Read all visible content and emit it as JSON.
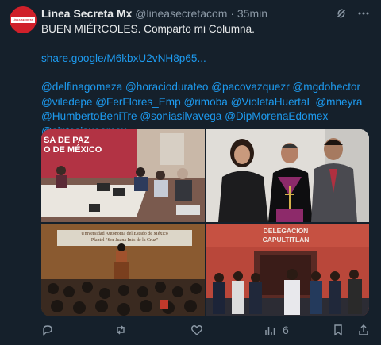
{
  "tweet": {
    "name": "Línea Secreta Mx",
    "handle": "@lineasecretacom",
    "separator": "·",
    "time": "35min",
    "avatar_text": "LÍNEA SECRETA",
    "line1": "BUEN MIÉRCOLES. Comparto mi Columna.",
    "link": "share.google/M6kbxU2vNH8p65...",
    "mentions_line1": "@delfinagomeza @horaciodurateo @pacovazquezr @mgdohector",
    "mentions_line2": "@viledepe @FerFlores_Emp @rimoba @VioletaHuertaL @mneyra",
    "mentions_line3": "@HumbertoBeniTre @soniasilvavega @DipMorenaEdomex",
    "mentions_line4": "@sintesisuaemex"
  },
  "photos": {
    "p1_sign": "SA DE PAZ\nO DE MÉXICO",
    "p3_banner": "Universidad Autónoma del Estado de México",
    "p3_sub": "Plantel \"Sor Juana Inés de la Cruz\"",
    "p4_sign1": "DELEGACION",
    "p4_sign2": "CAPULTITLAN"
  },
  "actions": {
    "views": "6"
  },
  "colors": {
    "background": "#15202b",
    "text": "#e7e9ea",
    "muted": "#8b98a5",
    "link": "#1d9bf0"
  }
}
